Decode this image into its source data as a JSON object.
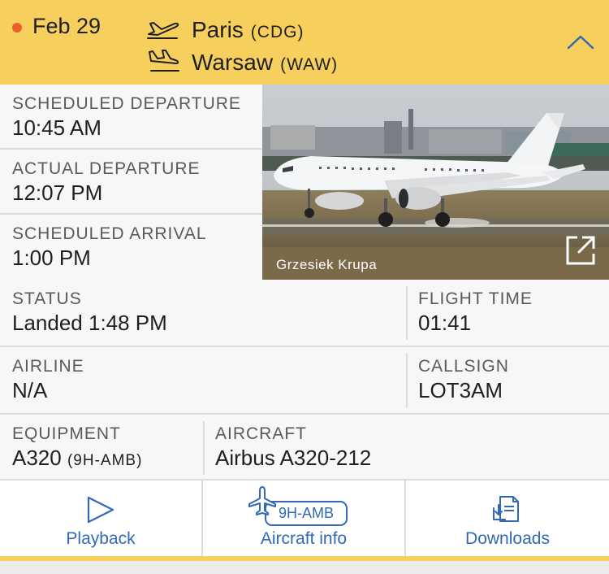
{
  "flight": {
    "date": "Feb 29",
    "status_color": "#e8612c",
    "origin": {
      "city": "Paris",
      "code": "(CDG)",
      "icon": "departure-plane-icon"
    },
    "destination": {
      "city": "Warsaw",
      "code": "(WAW)",
      "icon": "arrival-plane-icon"
    },
    "collapse_icon": "chevron-up-icon",
    "header_color": "#f6cf5c"
  },
  "times": {
    "scheduled_departure": {
      "label": "SCHEDULED DEPARTURE",
      "value": "10:45 AM"
    },
    "actual_departure": {
      "label": "ACTUAL DEPARTURE",
      "value": "12:07 PM"
    },
    "scheduled_arrival": {
      "label": "SCHEDULED ARRIVAL",
      "value": "1:00 PM"
    }
  },
  "photo": {
    "credit": "Grzesiek Krupa",
    "expand_icon": "external-link-icon"
  },
  "details": {
    "status": {
      "label": "STATUS",
      "value": "Landed 1:48 PM"
    },
    "flight_time": {
      "label": "FLIGHT TIME",
      "value": "01:41"
    },
    "airline": {
      "label": "AIRLINE",
      "value": "N/A"
    },
    "callsign": {
      "label": "CALLSIGN",
      "value": "LOT3AM"
    },
    "equipment": {
      "label": "EQUIPMENT",
      "value": "A320",
      "registration": "(9H-AMB)"
    },
    "aircraft": {
      "label": "AIRCRAFT",
      "value": "Airbus A320-212"
    }
  },
  "actions": {
    "playback": {
      "label": "Playback",
      "icon": "play-icon"
    },
    "aircraft_info": {
      "label": "Aircraft info",
      "icon": "plane-tag-icon",
      "tag": "9H-AMB"
    },
    "downloads": {
      "label": "Downloads",
      "icon": "download-document-icon"
    },
    "accent_color": "#3269b5"
  }
}
